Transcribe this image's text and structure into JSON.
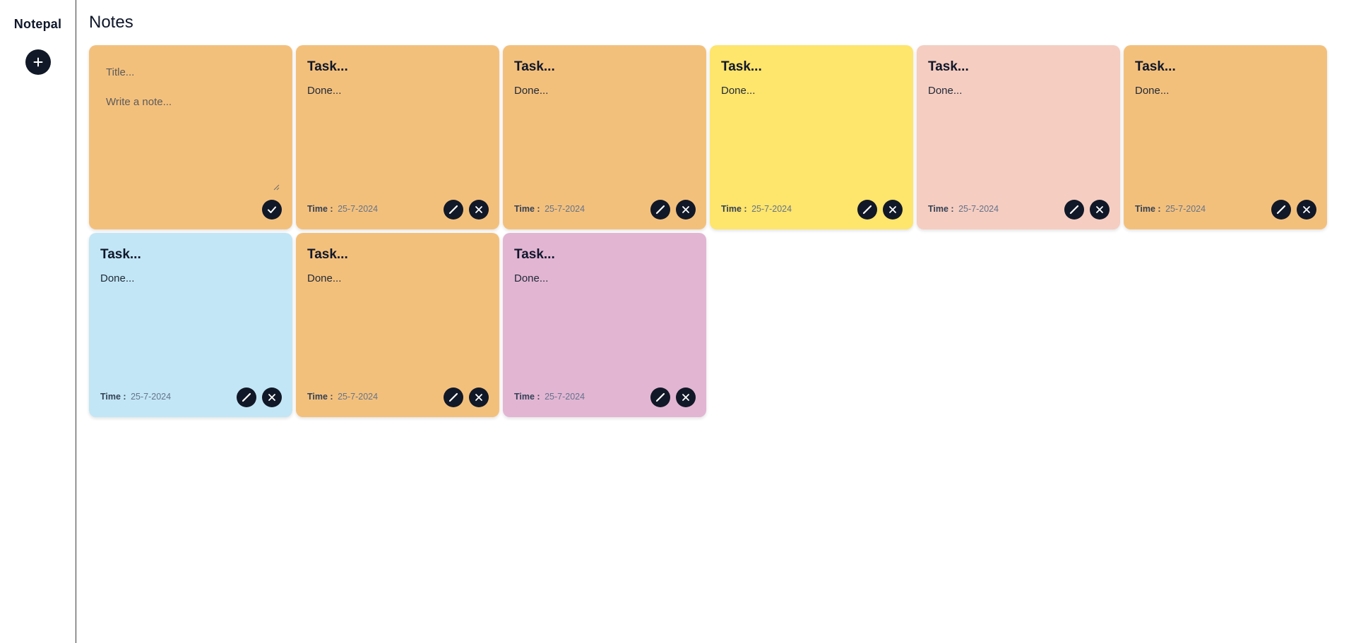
{
  "sidebar": {
    "brand": "Notepal",
    "add_icon": "plus-icon"
  },
  "main": {
    "title": "Notes"
  },
  "composer": {
    "color": "#F3C07C",
    "title_placeholder": "Title...",
    "note_placeholder": "Write a note...",
    "save_icon": "check-icon"
  },
  "notes": [
    {
      "title": "Task...",
      "text": "Done...",
      "time_label": "Time :",
      "time": "25-7-2024",
      "color": "#F3C07C"
    },
    {
      "title": "Task...",
      "text": "Done...",
      "time_label": "Time :",
      "time": "25-7-2024",
      "color": "#F3C07C"
    },
    {
      "title": "Task...",
      "text": "Done...",
      "time_label": "Time :",
      "time": "25-7-2024",
      "color": "#FEE56C"
    },
    {
      "title": "Task...",
      "text": "Done...",
      "time_label": "Time :",
      "time": "25-7-2024",
      "color": "#F5CDC1"
    },
    {
      "title": "Task...",
      "text": "Done...",
      "time_label": "Time :",
      "time": "25-7-2024",
      "color": "#F3C07C"
    },
    {
      "title": "Task...",
      "text": "Done...",
      "time_label": "Time :",
      "time": "25-7-2024",
      "color": "#C2E6F5"
    },
    {
      "title": "Task...",
      "text": "Done...",
      "time_label": "Time :",
      "time": "25-7-2024",
      "color": "#F3C07C"
    },
    {
      "title": "Task...",
      "text": "Done...",
      "time_label": "Time :",
      "time": "25-7-2024",
      "color": "#E2B5D3"
    }
  ],
  "actions": {
    "edit_icon": "pencil-icon",
    "delete_icon": "close-icon"
  }
}
